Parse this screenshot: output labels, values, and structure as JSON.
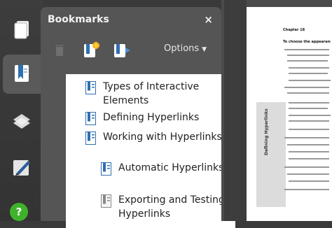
{
  "panel": {
    "title": "Bookmarks",
    "close_glyph": "×",
    "options_label": "Options"
  },
  "rail": {
    "items": [
      {
        "icon": "pages-icon"
      },
      {
        "icon": "bookmarks-icon"
      },
      {
        "icon": "layers-icon"
      },
      {
        "icon": "signatures-icon"
      },
      {
        "icon": "help-icon"
      }
    ]
  },
  "toolbar": {
    "icons": [
      "delete-bookmark-icon",
      "new-bookmark-icon",
      "expand-bookmark-icon"
    ]
  },
  "bookmarks": [
    {
      "label": "Types of Interactive Elements",
      "level": 0,
      "expanded": false
    },
    {
      "label": "Defining Hyperlinks",
      "level": 0,
      "expanded": false
    },
    {
      "label": "Working with Hyperlinks",
      "level": 0,
      "expanded": true
    },
    {
      "label": "Automatic Hyperlinks",
      "level": 1,
      "expanded": false
    },
    {
      "label": "Exporting and Testing Hyperlinks",
      "level": 1,
      "expanded": false
    }
  ],
  "document": {
    "chapter_label": "Chapter 18",
    "heading": "To choose the appearance of the hyperlink",
    "side_tab": "Defining Hyperlinks"
  },
  "colors": {
    "panel": "#555555",
    "list_bg": "#ffffff",
    "bookmark_icon": "#2f6fb0",
    "help": "#3fb22b"
  }
}
